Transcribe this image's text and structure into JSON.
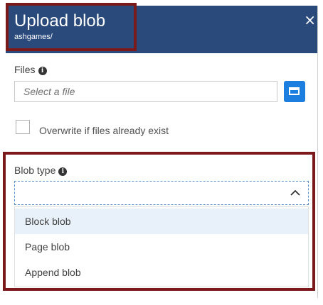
{
  "header": {
    "title": "Upload blob",
    "subtitle": "ashgames/",
    "close_glyph": "×"
  },
  "files": {
    "label": "Files",
    "info_glyph": "i",
    "placeholder": "Select a file"
  },
  "overwrite": {
    "label": "Overwrite if files already exist",
    "checked": false
  },
  "blob_type": {
    "label": "Blob type",
    "info_glyph": "i",
    "selected": "",
    "expanded": true,
    "options": [
      {
        "label": "Block blob"
      },
      {
        "label": "Page blob"
      },
      {
        "label": "Append blob"
      }
    ]
  },
  "colors": {
    "header_bg": "#2a4a7c",
    "accent": "#1c7fe0",
    "highlight_border": "#7a1a1a"
  }
}
